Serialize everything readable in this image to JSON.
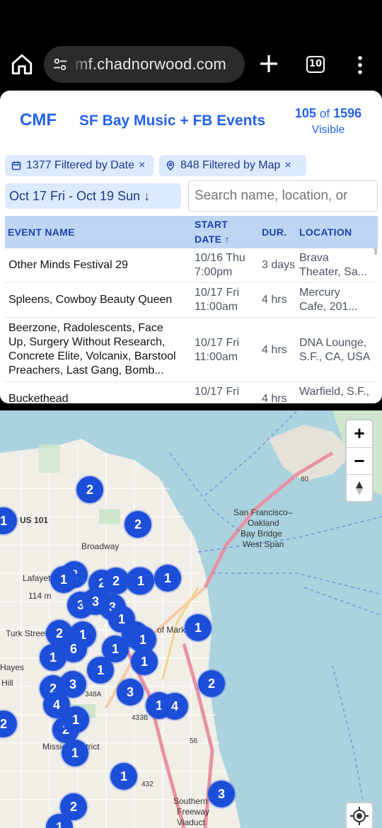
{
  "browser": {
    "url": "mf.chadnorwood.com",
    "tab_count": "10"
  },
  "header": {
    "logo": "CMF",
    "title": "SF Bay Music + FB Events",
    "visible_count": "105",
    "of": "of",
    "total_count": "1596",
    "visible_label": "Visible"
  },
  "filters": {
    "date_chip": "1377 Filtered by Date",
    "map_chip": "848 Filtered by Map",
    "remove": "×",
    "date_range": "Oct 17 Fri - Oct 19 Sun ↓",
    "search_placeholder": "Search name, location, or"
  },
  "table": {
    "columns": [
      "EVENT NAME",
      "START",
      "DATE ↑",
      "DUR.",
      "LOCATION"
    ],
    "rows": [
      {
        "name": "Other Minds Festival 29",
        "date1": "10/16 Thu",
        "date2": "7:00pm",
        "dur": "3 days",
        "loc1": "Brava",
        "loc2": "Theater, Sa..."
      },
      {
        "name": "Spleens, Cowboy Beauty Queen",
        "date1": "10/17 Fri",
        "date2": "11:00am",
        "dur": "4 hrs",
        "loc1": "Mercury",
        "loc2": "Cafe, 201..."
      },
      {
        "name": "Beerzone, Radolescents, Face",
        "name2": "Up, Surgery Without Research,",
        "name3": "Concrete Elite, Volcanix, Barstool",
        "name4": "Preachers, Last Gang, Bomb...",
        "date1": "10/17 Fri",
        "date2": "11:00am",
        "dur": "4 hrs",
        "loc1": "DNA Lounge,",
        "loc2": "S.F., CA, USA"
      },
      {
        "name": "Buckethead",
        "date1": "10/17 Fri",
        "dur": "4 hrs",
        "loc1": "Warfield, S.F.,"
      }
    ]
  },
  "map": {
    "labels": {
      "bridge1": "San Francisco–",
      "bridge2": "Oakland",
      "bridge3": "Bay Bridge",
      "bridge4": "West Span",
      "us101": "US 101",
      "broadway": "Broadway",
      "lafayette": "Lafayette",
      "height114": "114 m",
      "turk": "Turk Street",
      "hayes": "Hayes",
      "hill": "Hill",
      "market": "of Market",
      "mission": "Mission District",
      "southern1": "Southern",
      "southern2": "Freeway",
      "southern3": "Viaduct",
      "s80": "80",
      "s56": "56",
      "s433": "433B",
      "s348": "348A",
      "s432": "432"
    },
    "clusters": [
      "2",
      "2",
      "1",
      "2",
      "1",
      "1",
      "2",
      "2",
      "2",
      "1",
      "3",
      "3",
      "3",
      "1",
      "2",
      "1",
      "1",
      "1",
      "6",
      "1",
      "1",
      "1",
      "1",
      "1",
      "2",
      "3",
      "3",
      "2",
      "4",
      "1",
      "4",
      "2",
      "2",
      "1",
      "1",
      "1",
      "3",
      "2",
      "1"
    ]
  }
}
